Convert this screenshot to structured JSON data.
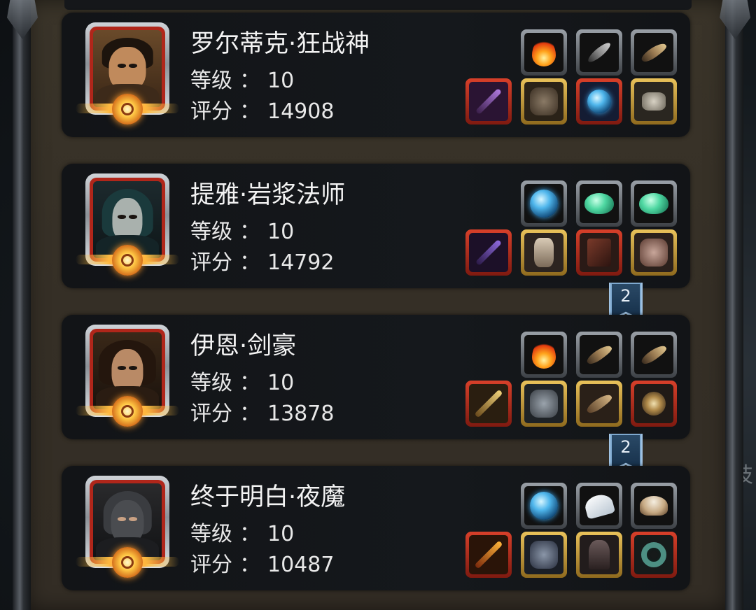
{
  "side_text": "技",
  "labels": {
    "level": "等级",
    "score": "评分",
    "colon": "："
  },
  "heroes": [
    {
      "name": "罗尔蒂克·狂战神",
      "level": "10",
      "score": "14908",
      "portrait": "hero-berserker-portrait",
      "skills": [
        {
          "icon": "fire-skill-icon",
          "type": "skill"
        },
        {
          "icon": "feather-skill-icon",
          "type": "skill"
        },
        {
          "icon": "claw-skill-icon",
          "type": "skill"
        }
      ],
      "equipment": [
        {
          "icon": "axe-weapon-icon",
          "rarity": "red"
        },
        {
          "icon": "armor-icon",
          "rarity": "gold"
        },
        {
          "icon": "amulet-icon",
          "rarity": "red"
        },
        {
          "icon": "ring-icon",
          "rarity": "gold"
        }
      ]
    },
    {
      "name": "提雅·岩浆法师",
      "level": "10",
      "score": "14792",
      "portrait": "hero-mage-portrait",
      "skills": [
        {
          "icon": "water-orb-skill-icon",
          "type": "skill"
        },
        {
          "icon": "green-gem-skill-icon",
          "type": "skill"
        },
        {
          "icon": "green-gem-skill-icon",
          "type": "skill"
        }
      ],
      "equipment": [
        {
          "icon": "staff-weapon-icon",
          "rarity": "red"
        },
        {
          "icon": "robe-icon",
          "rarity": "gold"
        },
        {
          "icon": "spellbook-icon",
          "rarity": "red"
        },
        {
          "icon": "gauntlet-icon",
          "rarity": "gold"
        }
      ],
      "rank_badge": "2"
    },
    {
      "name": "伊恩·剑豪",
      "level": "10",
      "score": "13878",
      "portrait": "hero-swordsman-portrait",
      "skills": [
        {
          "icon": "fire-skill-icon",
          "type": "skill"
        },
        {
          "icon": "claw-skill-icon",
          "type": "skill"
        },
        {
          "icon": "claw-skill-icon",
          "type": "skill"
        }
      ],
      "equipment": [
        {
          "icon": "sword-weapon-icon",
          "rarity": "red"
        },
        {
          "icon": "plate-armor-icon",
          "rarity": "gold"
        },
        {
          "icon": "bracer-icon",
          "rarity": "gold"
        },
        {
          "icon": "jewel-ring-icon",
          "rarity": "red"
        }
      ],
      "rank_badge": "2"
    },
    {
      "name": "终于明白·夜魔",
      "level": "10",
      "score": "10487",
      "portrait": "hero-assassin-portrait",
      "skills": [
        {
          "icon": "water-orb-skill-icon",
          "type": "skill"
        },
        {
          "icon": "wing-skill-icon",
          "type": "skill"
        },
        {
          "icon": "fur-skill-icon",
          "type": "skill"
        }
      ],
      "equipment": [
        {
          "icon": "dagger-weapon-icon",
          "rarity": "red"
        },
        {
          "icon": "leather-armor-icon",
          "rarity": "gold"
        },
        {
          "icon": "cloak-icon",
          "rarity": "gold"
        },
        {
          "icon": "jade-ring-icon",
          "rarity": "red"
        }
      ]
    }
  ]
}
